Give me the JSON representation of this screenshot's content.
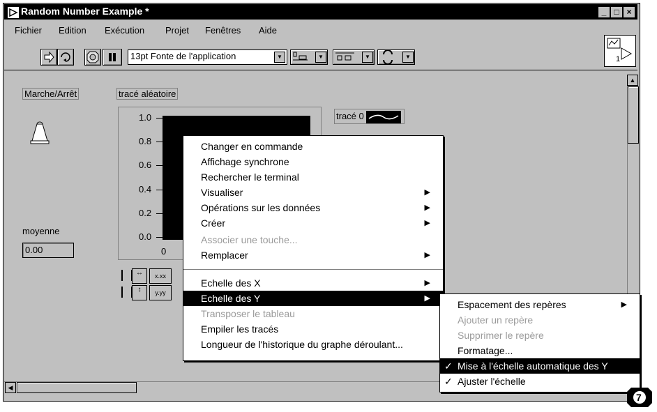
{
  "window": {
    "title": "Random Number Example *"
  },
  "window_controls": {
    "minimize": "_",
    "maximize": "□",
    "close": "×"
  },
  "menubar": [
    "Fichier",
    "Edition",
    "Exécution",
    "Projet",
    "Fenêtres",
    "Aide"
  ],
  "toolbar": {
    "font": "13pt Fonte de l'application"
  },
  "front_panel": {
    "switch_label": "Marche/Arrêt",
    "chart_label": "tracé aléatoire",
    "y_ticks": [
      "1.0",
      "0.8",
      "0.6",
      "0.4",
      "0.2",
      "0.0"
    ],
    "x_tick": "0",
    "plot_legend": "tracé 0",
    "mean_label": "moyenne",
    "mean_value": "0.00",
    "scale_x_btn": "x.xx",
    "scale_y_btn": "y.yy"
  },
  "context_menu": {
    "items": [
      {
        "label": "Changer en commande",
        "disabled": false,
        "submenu": false
      },
      {
        "label": "Affichage synchrone",
        "disabled": false,
        "submenu": false
      },
      {
        "label": "Rechercher le terminal",
        "disabled": false,
        "submenu": false
      },
      {
        "label": "Visualiser",
        "disabled": false,
        "submenu": true
      },
      {
        "label": "Opérations sur les données",
        "disabled": false,
        "submenu": true
      },
      {
        "label": "Créer",
        "disabled": false,
        "submenu": true
      },
      {
        "label": "Associer une touche...",
        "disabled": true,
        "submenu": false
      },
      {
        "label": "Remplacer",
        "disabled": false,
        "submenu": true
      },
      {
        "label": "Echelle des X",
        "disabled": false,
        "submenu": true
      },
      {
        "label": "Echelle des Y",
        "disabled": false,
        "submenu": true,
        "selected": true
      },
      {
        "label": "Transposer le tableau",
        "disabled": true,
        "submenu": false
      },
      {
        "label": "Empiler les tracés",
        "disabled": false,
        "submenu": false
      },
      {
        "label": "Longueur de l'historique du graphe déroulant...",
        "disabled": false,
        "submenu": false
      }
    ]
  },
  "submenu": {
    "items": [
      {
        "label": "Espacement des repères",
        "disabled": false,
        "submenu": true,
        "checked": false
      },
      {
        "label": "Ajouter un repère",
        "disabled": true,
        "submenu": false,
        "checked": false
      },
      {
        "label": "Supprimer le repère",
        "disabled": true,
        "submenu": false,
        "checked": false
      },
      {
        "label": "Formatage...",
        "disabled": false,
        "submenu": false,
        "checked": false
      },
      {
        "label": "Mise à l'échelle automatique des Y",
        "disabled": false,
        "submenu": false,
        "checked": true,
        "selected": true
      },
      {
        "label": "Ajuster l'échelle",
        "disabled": false,
        "submenu": false,
        "checked": true
      }
    ],
    "check_glyph": "✓"
  },
  "corner_badge": {
    "number": "7"
  },
  "vi_icon_number": "1",
  "icons": [
    "run-arrow-icon",
    "run-continuous-icon",
    "abort-icon",
    "pause-icon",
    "align-icon",
    "distribute-icon",
    "reorder-icon",
    "up-arrow-icon",
    "left-arrow-icon",
    "submenu-arrow-icon"
  ]
}
